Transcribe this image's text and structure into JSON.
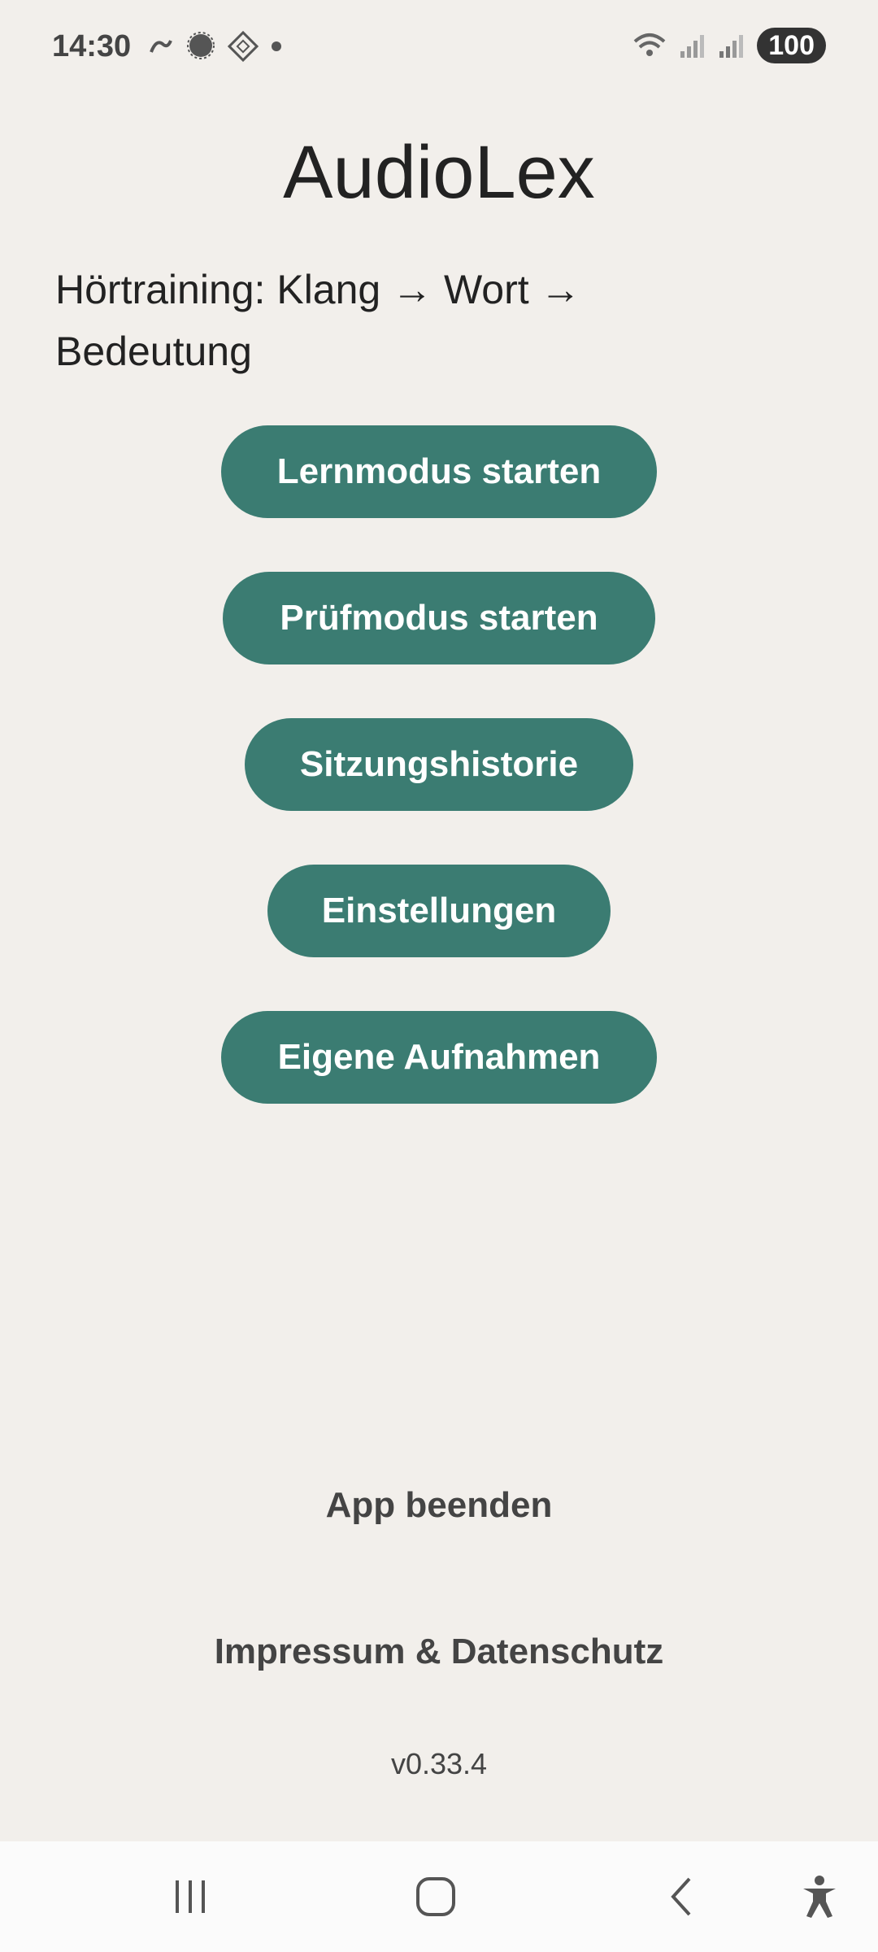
{
  "status_bar": {
    "time": "14:30",
    "battery": "100",
    "left_icons": [
      "notification-icon",
      "chat-bubble-icon",
      "app-icon",
      "dot-icon"
    ],
    "right_icons": [
      "wifi-icon",
      "signal-icon",
      "signal-roaming-icon"
    ]
  },
  "app": {
    "title": "AudioLex",
    "subtitle": "Hörtraining: Klang → Wort → Bedeutung"
  },
  "buttons": {
    "learn": "Lernmodus starten",
    "exam": "Prüfmodus starten",
    "history": "Sitzungshistorie",
    "settings": "Einstellungen",
    "recordings": "Eigene Aufnahmen"
  },
  "links": {
    "exit": "App beenden",
    "imprint": "Impressum & Datenschutz"
  },
  "version": "v0.33.4",
  "colors": {
    "background": "#f2efeb",
    "button": "#3b7c72",
    "button_text": "#ffffff"
  }
}
